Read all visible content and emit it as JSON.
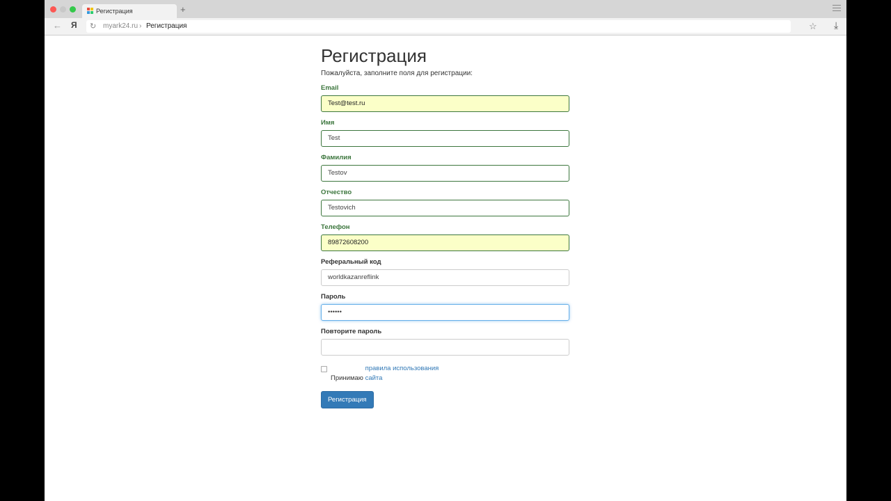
{
  "browser": {
    "tab_title": "Регистрация",
    "new_tab": "+",
    "url_domain": "myark24.ru",
    "url_separator": "›",
    "url_path": "Регистрация",
    "back_glyph": "←",
    "yandex_glyph": "Я",
    "refresh_glyph": "↻",
    "lock_glyph": "🔒",
    "star_glyph": "☆",
    "download_glyph": "⤓"
  },
  "page": {
    "title": "Регистрация",
    "intro": "Пожалуйста, заполните поля для регистрации:",
    "fields": [
      {
        "label": "Email",
        "value": "Test@test.ru"
      },
      {
        "label": "Имя",
        "value": "Test"
      },
      {
        "label": "Фамилия",
        "value": "Testov"
      },
      {
        "label": "Отчество",
        "value": "Testovich"
      },
      {
        "label": "Телефон",
        "value": "89872608200"
      },
      {
        "label": "Реферальный код",
        "value": "worldkazanreflink"
      },
      {
        "label": "Пароль",
        "value": "••••••"
      },
      {
        "label": "Повторите пароль",
        "value": ""
      }
    ],
    "agree_prefix": "Принимаю",
    "agree_link": "правила использования сайта",
    "submit_label": "Регистрация"
  },
  "colors": {
    "valid": "#3c763d",
    "autofill": "#fbffc8",
    "primary": "#337ab7",
    "focus": "#66afe9"
  }
}
